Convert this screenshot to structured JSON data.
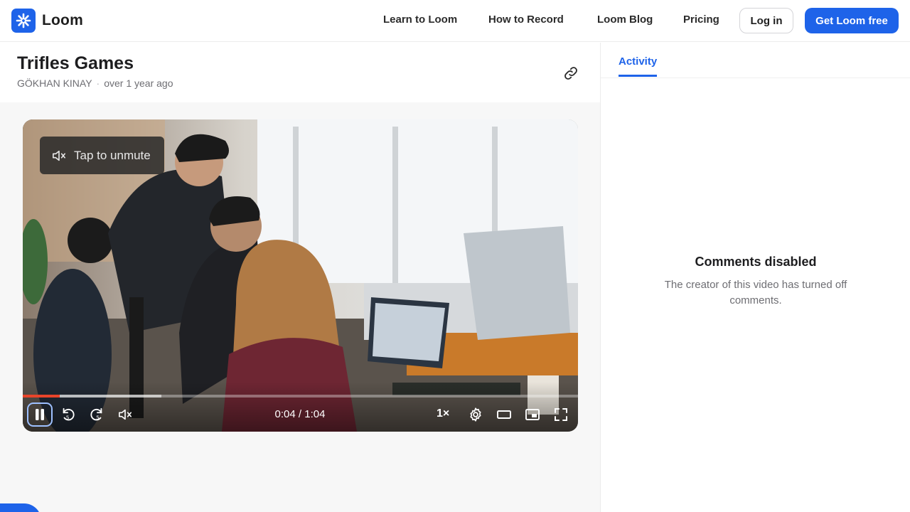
{
  "header": {
    "brand": "Loom",
    "nav": [
      "Learn to Loom",
      "How to Record",
      "Loom Blog",
      "Pricing"
    ],
    "login_label": "Log in",
    "cta_label": "Get Loom free",
    "accent_color": "#1e63e9"
  },
  "video": {
    "title": "Trifles Games",
    "author": "GÖKHAN KINAY",
    "age": "over 1 year ago",
    "unmute_label": "Tap to unmute",
    "time": "0:04 / 1:04",
    "speed": "1×",
    "progress_fraction": 0.067,
    "buffer_fraction": 0.25
  },
  "icons": {
    "link": "link-icon",
    "mute": "speaker-muted-icon",
    "pause": "pause-icon",
    "rewind": "rewind-5-icon",
    "forward": "forward-5-icon",
    "settings": "gear-icon",
    "theater": "theater-mode-icon",
    "pip": "picture-in-picture-icon",
    "fullscreen": "fullscreen-icon",
    "record": "video-camera-icon"
  },
  "sidebar": {
    "tab": "Activity",
    "empty_title": "Comments disabled",
    "empty_text": "The creator of this video has turned off comments."
  }
}
